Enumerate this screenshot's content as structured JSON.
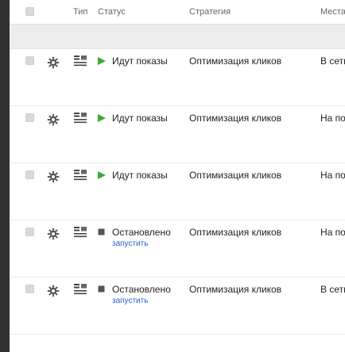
{
  "header": {
    "type_label": "Тип",
    "status_label": "Статус",
    "strategy_label": "Стратегия",
    "places_label": "Места"
  },
  "rows": [
    {
      "status": "Идут показы",
      "status_kind": "running",
      "action": "",
      "strategy": "Оптимизация кликов",
      "place": "В сети"
    },
    {
      "status": "Идут показы",
      "status_kind": "running",
      "action": "",
      "strategy": "Оптимизация кликов",
      "place": "На по"
    },
    {
      "status": "Идут показы",
      "status_kind": "running",
      "action": "",
      "strategy": "Оптимизация кликов",
      "place": "На по"
    },
    {
      "status": "Остановлено",
      "status_kind": "stopped",
      "action": "запустить",
      "strategy": "Оптимизация кликов",
      "place": "На по"
    },
    {
      "status": "Остановлено",
      "status_kind": "stopped",
      "action": "запустить",
      "strategy": "Оптимизация кликов",
      "place": "В сети"
    }
  ],
  "colors": {
    "running": "#3aaa35",
    "stopped": "#555555",
    "link": "#2a5bd7"
  },
  "icons": {
    "settings": "gear-icon",
    "type": "text-ad-icon",
    "running": "play-icon",
    "stopped": "stop-icon"
  }
}
